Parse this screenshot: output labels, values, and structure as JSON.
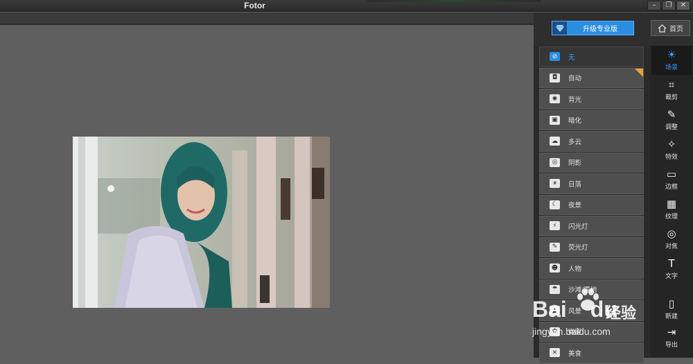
{
  "app": {
    "title": "Fotor"
  },
  "window_controls": {
    "minimize": "–",
    "restore": "❐",
    "close": "✕"
  },
  "header": {
    "upgrade_label": "升级专业版",
    "home_label": "首页"
  },
  "scene_list": [
    {
      "label": "无",
      "icon": "no-icon",
      "glyph": "⊘"
    },
    {
      "label": "自动",
      "icon": "camera-icon",
      "glyph": "◘"
    },
    {
      "label": "背光",
      "icon": "backlight-icon",
      "glyph": "✺"
    },
    {
      "label": "暗化",
      "icon": "darken-icon",
      "glyph": "▣"
    },
    {
      "label": "多云",
      "icon": "cloud-icon",
      "glyph": "☁"
    },
    {
      "label": "阴影",
      "icon": "shadow-icon",
      "glyph": "◎"
    },
    {
      "label": "日落",
      "icon": "sunset-icon",
      "glyph": "☀"
    },
    {
      "label": "夜景",
      "icon": "moon-icon",
      "glyph": "☾"
    },
    {
      "label": "闪光灯",
      "icon": "flash-icon",
      "glyph": "⚡"
    },
    {
      "label": "荧光灯",
      "icon": "bulb-icon",
      "glyph": "✎"
    },
    {
      "label": "人物",
      "icon": "person-icon",
      "glyph": "☻"
    },
    {
      "label": "沙滩/雪地",
      "icon": "beach-icon",
      "glyph": "☂"
    },
    {
      "label": "风景",
      "icon": "landscape-icon",
      "glyph": "▲"
    },
    {
      "label": "微距",
      "icon": "flower-icon",
      "glyph": "✿"
    },
    {
      "label": "美食",
      "icon": "food-icon",
      "glyph": "✕"
    }
  ],
  "tools": [
    {
      "label": "场景",
      "icon": "sun-icon",
      "glyph": "☀"
    },
    {
      "label": "裁剪",
      "icon": "crop-icon",
      "glyph": "⌗"
    },
    {
      "label": "调整",
      "icon": "pencil-icon",
      "glyph": "✎"
    },
    {
      "label": "特效",
      "icon": "sparkle-icon",
      "glyph": "✧"
    },
    {
      "label": "边框",
      "icon": "frame-icon",
      "glyph": "▭"
    },
    {
      "label": "纹理",
      "icon": "texture-icon",
      "glyph": "▦"
    },
    {
      "label": "对焦",
      "icon": "focus-icon",
      "glyph": "◎"
    },
    {
      "label": "文字",
      "icon": "text-icon",
      "glyph": "T"
    },
    {
      "label": "新建",
      "icon": "new-file-icon",
      "glyph": "▯"
    },
    {
      "label": "导出",
      "icon": "export-icon",
      "glyph": "⇥"
    }
  ],
  "watermark": {
    "logo": "Bai",
    "logo_end": "du",
    "cn": "经验",
    "url": "jingyan.baidu.com"
  },
  "colors": {
    "accent": "#2a8de0",
    "badge": "#e6a23c"
  }
}
